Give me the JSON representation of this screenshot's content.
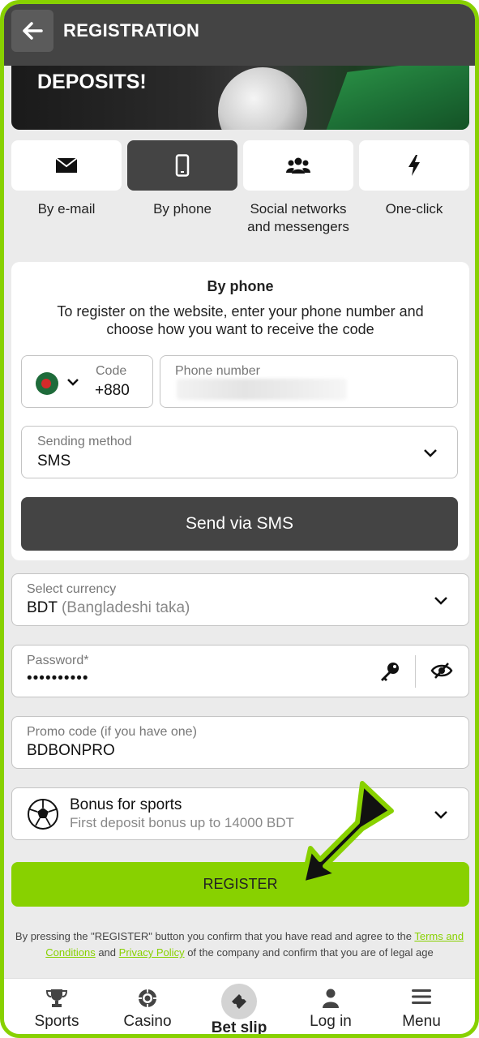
{
  "header": {
    "title": "REGISTRATION"
  },
  "banner": {
    "headline": "DEPOSITS!"
  },
  "methods": [
    {
      "label": "By e-mail",
      "icon": "envelope-icon"
    },
    {
      "label": "By phone",
      "icon": "phone-icon",
      "active": true
    },
    {
      "label": "Social networks and messengers",
      "label_line1": "Social networks",
      "label_line2": "and messengers",
      "icon": "users-icon"
    },
    {
      "label": "One-click",
      "icon": "lightning-icon"
    }
  ],
  "phone_form": {
    "title": "By phone",
    "description": "To register on the website, enter your phone number and choose how you want to receive the code",
    "code_label": "Code",
    "code_value": "+880",
    "phone_label": "Phone number",
    "sending_label": "Sending method",
    "sending_value": "SMS",
    "send_button": "Send via SMS"
  },
  "currency": {
    "label": "Select currency",
    "code": "BDT",
    "name": "(Bangladeshi taka)"
  },
  "password": {
    "label": "Password*",
    "value": "••••••••••"
  },
  "promo": {
    "label": "Promo code (if you have one)",
    "value": "BDBONPRO"
  },
  "bonus": {
    "title": "Bonus for sports",
    "subtitle": "First deposit bonus up to 14000 BDT"
  },
  "register_button": "REGISTER",
  "terms": {
    "prefix": "By pressing the \"REGISTER\" button you confirm that you have read and agree to the",
    "terms_link": "Terms and Conditions",
    "and": "and",
    "privacy_link": "Privacy Policy",
    "suffix": "of the company and confirm that you are of legal age"
  },
  "bottom_nav": [
    {
      "label": "Sports",
      "icon": "trophy-icon"
    },
    {
      "label": "Casino",
      "icon": "chip-icon"
    },
    {
      "label": "Bet slip",
      "icon": "ticket-icon"
    },
    {
      "label": "Log in",
      "icon": "user-icon"
    },
    {
      "label": "Menu",
      "icon": "hamburger-icon"
    }
  ],
  "colors": {
    "accent": "#88d100",
    "dark": "#444444",
    "background": "#ebebeb"
  }
}
